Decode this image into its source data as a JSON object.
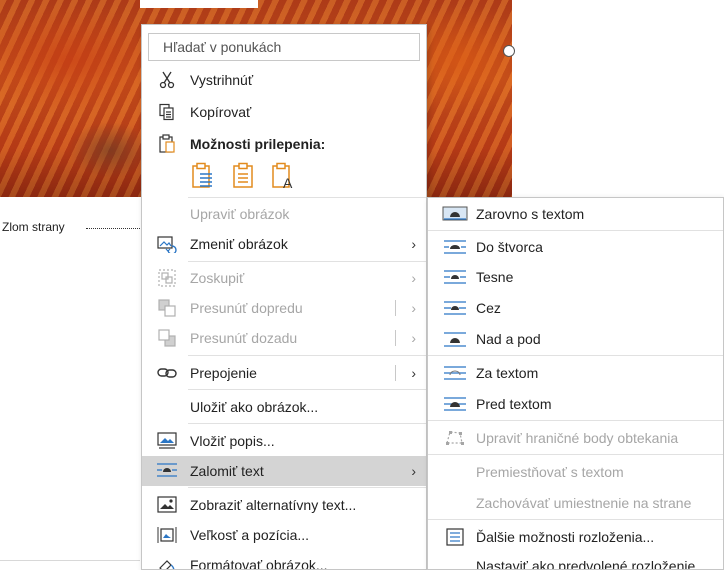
{
  "document": {
    "page_break_label": "Zlom strany"
  },
  "context_menu": {
    "search_placeholder": "Hľadať v ponukách",
    "items": {
      "cut": "Vystrihnúť",
      "copy": "Kopírovať",
      "paste_options": "Možnosti prilepenia:",
      "edit_picture": "Upraviť obrázok",
      "change_picture": "Zmeniť obrázok",
      "group": "Zoskupiť",
      "bring_forward": "Presunúť dopredu",
      "send_backward": "Presunúť dozadu",
      "link": "Prepojenie",
      "save_as_picture": "Uložiť ako obrázok...",
      "insert_caption": "Vložiť popis...",
      "wrap_text": "Zalomiť text",
      "edit_alt_text": "Zobraziť alternatívny text...",
      "size_position": "Veľkosť a pozícia...",
      "format_picture": "Formátovať obrázok..."
    },
    "arrow": "›"
  },
  "wrap_submenu": {
    "items": {
      "in_line": "Zarovno s textom",
      "square": "Do štvorca",
      "tight": "Tesne",
      "through": "Cez",
      "top_bottom": "Nad a pod",
      "behind_text": "Za textom",
      "in_front_text": "Pred textom",
      "edit_wrap_points": "Upraviť hraničné body obtekania",
      "move_with_text": "Premiestňovať s textom",
      "fix_position": "Zachovávať umiestnenie na strane",
      "more_layout": "Ďalšie možnosti rozloženia...",
      "set_default": "Nastaviť ako predvolené rozloženie"
    }
  },
  "colors": {
    "accent_icon": "#2b76c5",
    "paste_icon": "#e28b1e",
    "disabled_text": "#a6a6a6",
    "highlight": "#d4d4d4"
  }
}
